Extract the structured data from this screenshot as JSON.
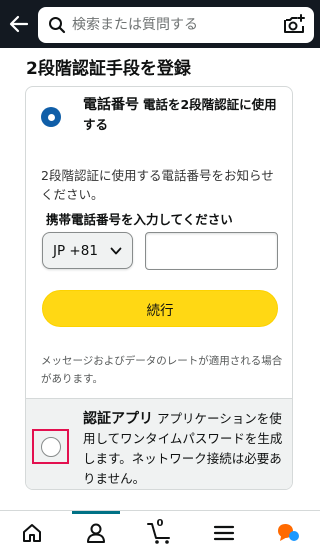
{
  "search": {
    "placeholder": "検索または質問する"
  },
  "page": {
    "title": "2段階認証手段を登録"
  },
  "phone_option": {
    "label": "電話番号",
    "description": "電話を2段階認証に使用する",
    "selected": true
  },
  "phone_form": {
    "info": "2段階認証に使用する電話番号をお知らせください。",
    "field_label": "携帯電話番号を入力してください",
    "country_code": "JP +81",
    "phone_value": "",
    "continue_label": "続行",
    "notice": "メッセージおよびデータのレートが適用される場合があります。"
  },
  "app_option": {
    "label": "認証アプリ",
    "description": "アプリケーションを使用してワンタイムパスワードを生成します。ネットワーク接続は必要ありません。",
    "selected": false
  },
  "bottom_nav": {
    "items": [
      "home-icon",
      "account-icon",
      "cart-icon",
      "menu-icon",
      "assistant-icon"
    ],
    "active": "account-icon",
    "cart_count": "0"
  },
  "colors": {
    "header": "#131921",
    "accent_blue": "#0f5ea8",
    "button_yellow": "#ffd814",
    "highlight_pink": "#e3104f",
    "assistant_orange": "#ff6a00",
    "assistant_blue": "#1a98ff"
  }
}
